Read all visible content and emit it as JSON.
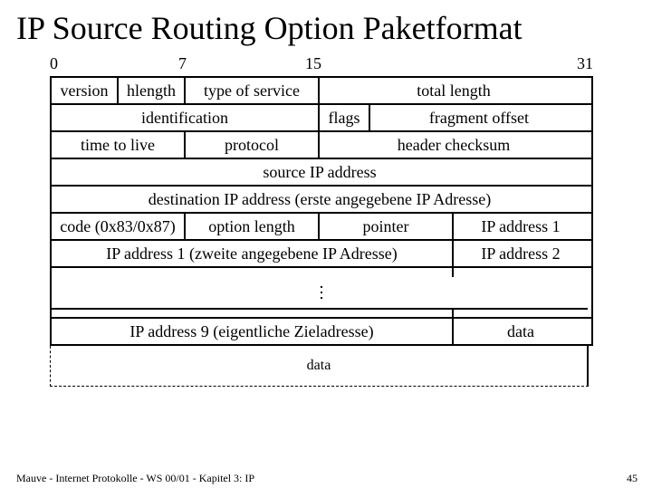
{
  "title": "IP Source Routing Option Paketformat",
  "bits": {
    "b0": "0",
    "b7": "7",
    "b15": "15",
    "b31": "31"
  },
  "hdr": {
    "version": "version",
    "hlength": "hlength",
    "tos": "type of service",
    "totlen": "total length",
    "ident": "identification",
    "flags": "flags",
    "fragoff": "fragment offset",
    "ttl": "time to live",
    "proto": "protocol",
    "checksum": "header checksum",
    "src": "source IP address",
    "dst": "destination IP address (erste angegebene IP Adresse)"
  },
  "opt": {
    "code": "code (0x83/0x87)",
    "len": "option length",
    "ptr": "pointer",
    "ip1a": "IP address 1",
    "ip1b": "IP address 1 (zweite angegebene IP Adresse)",
    "ip2": "IP address 2",
    "ip9": "IP address 9 (eigentliche Zieladresse)",
    "data_a": "data",
    "data_b": "data"
  },
  "footer": "Mauve - Internet Protokolle - WS 00/01 - Kapitel 3: IP",
  "page": "45"
}
